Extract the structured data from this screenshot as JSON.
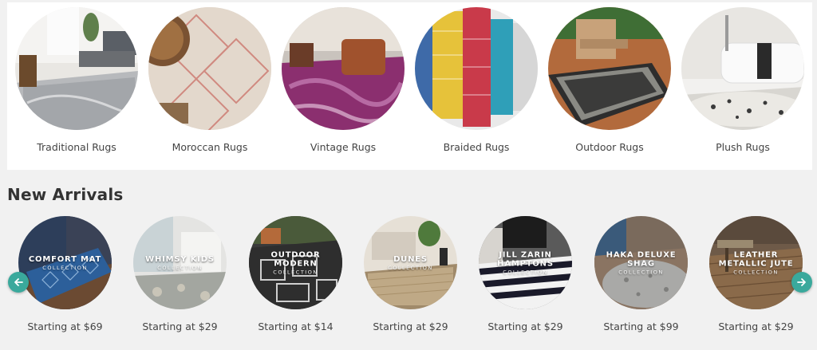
{
  "categories": [
    {
      "label": "Traditional Rugs",
      "image": "traditional-rug-photo"
    },
    {
      "label": "Moroccan Rugs",
      "image": "moroccan-rug-photo"
    },
    {
      "label": "Vintage Rugs",
      "image": "vintage-rug-photo"
    },
    {
      "label": "Braided Rugs",
      "image": "braided-rug-photo"
    },
    {
      "label": "Outdoor Rugs",
      "image": "outdoor-rug-photo"
    },
    {
      "label": "Plush Rugs",
      "image": "plush-rug-photo"
    }
  ],
  "new_arrivals": {
    "title": "New Arrivals",
    "collection_word": "COLLECTION",
    "items": [
      {
        "name": "COMFORT MAT",
        "price": "Starting at $69"
      },
      {
        "name": "WHIMSY KIDS",
        "price": "Starting at $29"
      },
      {
        "name": "OUTDOOR MODERN",
        "price": "Starting at $14"
      },
      {
        "name": "DUNES",
        "price": "Starting at $29"
      },
      {
        "name": "JILL ZARIN HAMPTONS",
        "price": "Starting at $29"
      },
      {
        "name": "HAKA DELUXE SHAG",
        "price": "Starting at $99"
      },
      {
        "name": "LEATHER METALLIC JUTE",
        "price": "Starting at $29"
      }
    ]
  },
  "carousel": {
    "prev_icon": "arrow-left-icon",
    "next_icon": "arrow-right-icon"
  },
  "colors": {
    "accent": "#3aa99c",
    "panel": "#ffffff",
    "background": "#f1f1f1"
  }
}
